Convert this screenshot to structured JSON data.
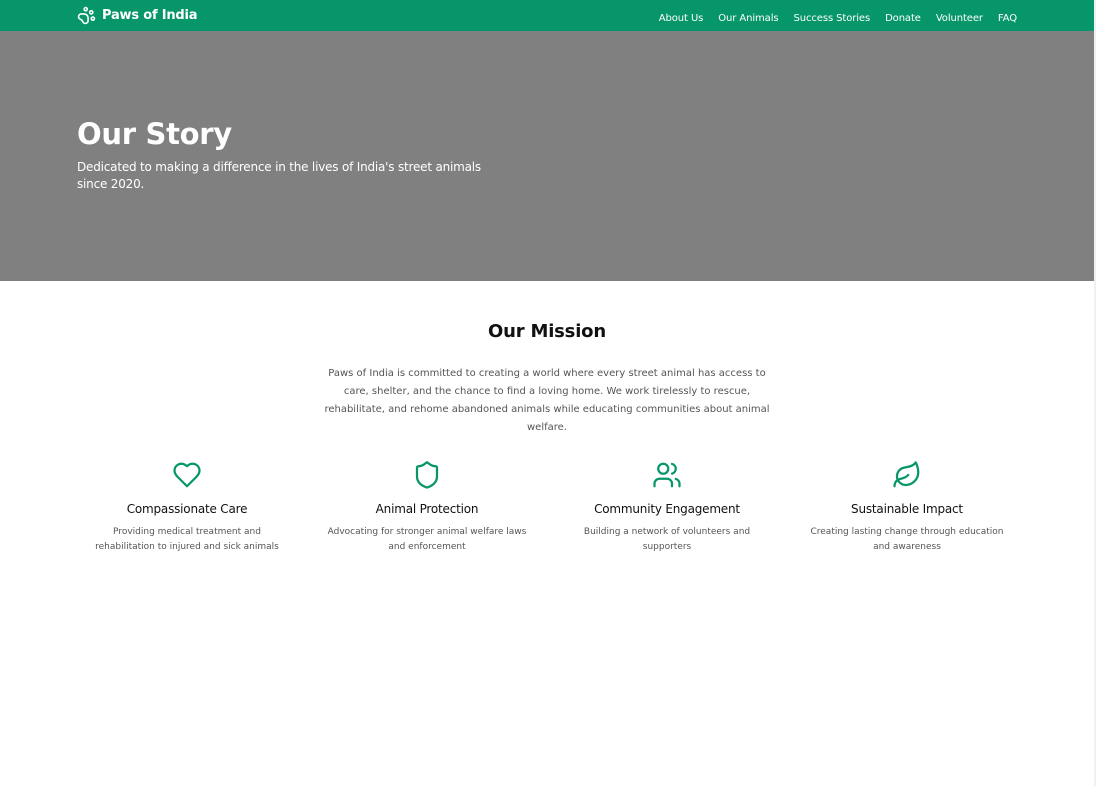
{
  "brand": {
    "name": "Paws of India",
    "icon": "paw-icon",
    "color": "#079669"
  },
  "nav": {
    "items": [
      {
        "label": "About Us"
      },
      {
        "label": "Our Animals"
      },
      {
        "label": "Success Stories"
      },
      {
        "label": "Donate"
      },
      {
        "label": "Volunteer"
      },
      {
        "label": "FAQ"
      }
    ]
  },
  "hero": {
    "title": "Our Story",
    "subtitle": "Dedicated to making a difference in the lives of India's street animals since 2020.",
    "background": "#808080"
  },
  "mission": {
    "title": "Our Mission",
    "text": "Paws of India is committed to creating a world where every street animal has access to care, shelter, and the chance to find a loving home. We work tirelessly to rescue, rehabilitate, and rehome abandoned animals while educating communities about animal welfare."
  },
  "features": [
    {
      "icon": "heart-icon",
      "title": "Compassionate Care",
      "text": "Providing medical treatment and rehabilitation to injured and sick animals"
    },
    {
      "icon": "shield-icon",
      "title": "Animal Protection",
      "text": "Advocating for stronger animal welfare laws and enforcement"
    },
    {
      "icon": "users-icon",
      "title": "Community Engagement",
      "text": "Building a network of volunteers and supporters"
    },
    {
      "icon": "leaf-icon",
      "title": "Sustainable Impact",
      "text": "Creating lasting change through education and awareness"
    }
  ]
}
